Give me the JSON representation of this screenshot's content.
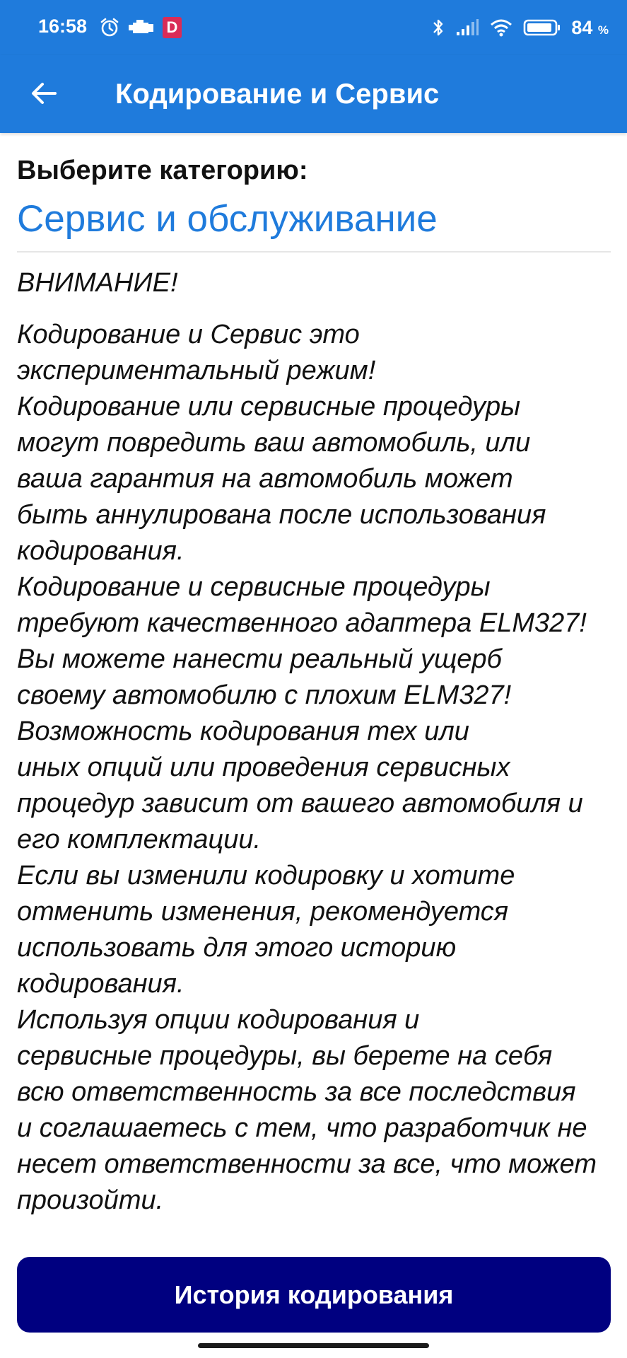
{
  "status_bar": {
    "time": "16:58",
    "notification_badge": "D",
    "battery_percent": "84",
    "battery_unit": "%"
  },
  "app_bar": {
    "title": "Кодирование и Сервис",
    "back_icon": "arrow-left-icon"
  },
  "category": {
    "label": "Выберите категорию:",
    "value": "Сервис и обслуживание"
  },
  "warning": {
    "title": "ВНИМАНИЕ!",
    "body": "Кодирование и Сервис это\nэкспериментальный режим!\nКодирование или сервисные процедуры\nмогут повредить ваш автомобиль, или\nваша гарантия на автомобиль может\nбыть аннулирована после использования\nкодирования.\nКодирование и сервисные процедуры\nтребуют качественного адаптера ELM327!\nВы можете нанести реальный ущерб\nсвоему автомобилю с плохим ELM327!\nВозможность кодирования тех или\nиных опций или проведения сервисных\nпроцедур зависит от вашего автомобиля и\nего комплектации.\nЕсли вы изменили кодировку и хотите\nотменить изменения, рекомендуется\nиспользовать для этого историю\nкодирования.\nИспользуя опции кодирования и\nсервисные процедуры, вы берете на себя\nвсю ответственность за все последствия\nи соглашаетесь с тем, что разработчик не\nнесет ответственности за все, что может\nпроизойти."
  },
  "actions": {
    "history_button": "История кодирования"
  },
  "colors": {
    "primary": "#1f7bdc",
    "button": "#000080",
    "badge": "#d92c57"
  }
}
